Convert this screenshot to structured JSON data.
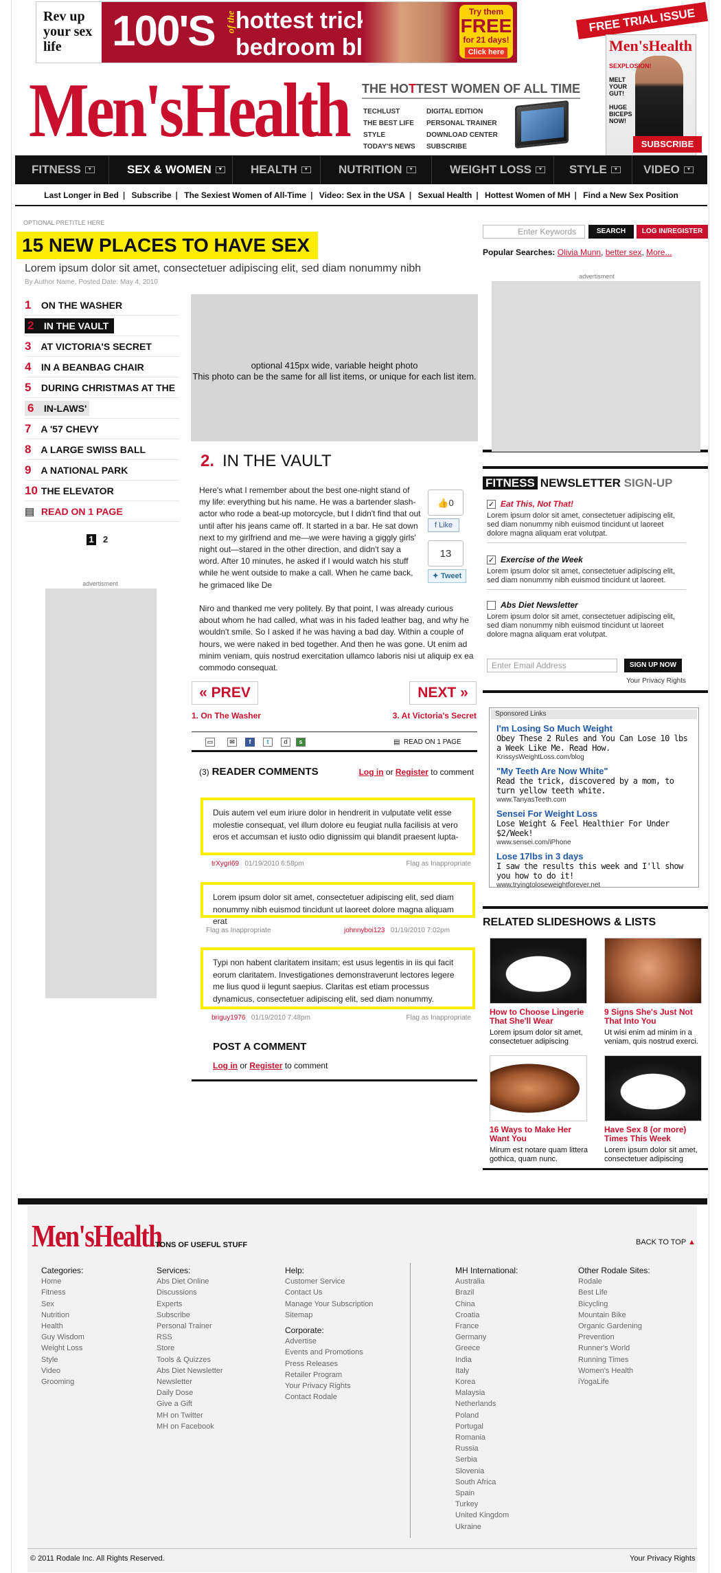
{
  "ad_top": {
    "left_text": "Rev up your sex life",
    "big": "100'S",
    "of_the": "of the",
    "line1": "hottest tricks",
    "line1_for": "for",
    "line2": "bedroom bliss",
    "try": "Try them",
    "free": "FREE",
    "days": "for 21 days!",
    "cta": "Click here"
  },
  "trial": {
    "label": "FREE TRIAL ISSUE",
    "cover_title": "Men'sHealth",
    "cover_text": [
      "SEXPLOSION!",
      "MELT YOUR GUT!",
      "HUGE BICEPS NOW!"
    ],
    "subscribe": "SUBSCRIBE"
  },
  "header": {
    "logo": "Men'sHealth",
    "hottest_pre": "THE HO",
    "hottest_accent": "T",
    "hottest_post": "TEST WOMEN OF ALL TIME",
    "links_col1": [
      "TECHLUST",
      "THE BEST LIFE",
      "STYLE",
      "TODAY'S NEWS"
    ],
    "links_col2": [
      "DIGITAL EDITION",
      "PERSONAL TRAINER",
      "DOWNLOAD CENTER",
      "SUBSCRIBE"
    ]
  },
  "nav": {
    "items": [
      {
        "label": "FITNESS"
      },
      {
        "label": "SEX & WOMEN"
      },
      {
        "label": "HEALTH"
      },
      {
        "label": "NUTRITION"
      },
      {
        "label": "WEIGHT LOSS"
      },
      {
        "label": "STYLE"
      },
      {
        "label": "VIDEO"
      }
    ],
    "active_index": 1,
    "subnav": [
      "Last Longer in Bed",
      "Subscribe",
      "The Sexiest Women of All-Time",
      "Video: Sex in the USA",
      "Sexual Health",
      "Hottest Women of MH",
      "Find a New Sex Position"
    ]
  },
  "article": {
    "pretitle": "OPTIONAL PRETITLE HERE",
    "title": "15 NEW PLACES TO HAVE SEX",
    "dek": "Lorem ipsum dolor sit amet, consectetuer adipiscing elit, sed diam nonummy nibh",
    "byline": "By Author Name, Posted Date: May 4, 2010",
    "list": [
      {
        "n": "1",
        "label": "ON THE WASHER"
      },
      {
        "n": "2",
        "label": "IN THE VAULT"
      },
      {
        "n": "3",
        "label": "AT VICTORIA'S SECRET"
      },
      {
        "n": "4",
        "label": "IN A BEANBAG CHAIR"
      },
      {
        "n": "5",
        "label": "DURING CHRISTMAS AT THE"
      },
      {
        "n": "6",
        "label": "IN-LAWS'"
      },
      {
        "n": "7",
        "label": "A '57 CHEVY"
      },
      {
        "n": "8",
        "label": "A LARGE SWISS BALL"
      },
      {
        "n": "9",
        "label": "A NATIONAL PARK"
      },
      {
        "n": "10",
        "label": "THE ELEVATOR"
      }
    ],
    "read_on_one": "READ ON 1 PAGE",
    "pages": [
      "1",
      "2"
    ],
    "ad_label": "advertisment",
    "photo_line1": "optional 415px wide, variable height photo",
    "photo_line2": "This photo can be the same for all list items, or unique for each list item.",
    "section_num": "2.",
    "section_title": "IN THE VAULT",
    "body_narrow": "Here's what I remember about the best one-night stand of my life: everything but his name. He was a bartender slash-actor who rode a beat-up motorcycle, but I didn't find that out until after his jeans came off. It started in a bar. He sat down next to my girlfriend and me—we were having a giggly girls' night out—stared in the other direction, and didn't say a word.  After 10 minutes, he asked if I would watch his stuff while he went outside to make a call. When he came back, he grimaced like De",
    "body_wide": "Niro and thanked me very politely. By that point, I was already curious about whom he had called, what was in his faded leather bag, and why he wouldn't smile. So I asked if he was having a bad day. Within a couple of hours, we were naked in bed together. And then he was gone. Ut enim ad minim veniam, quis nostrud exercitation ullamco laboris nisi ut aliquip ex ea commodo consequat.",
    "like_count": "0",
    "like_label": "Like",
    "tweet_count": "13",
    "tweet_label": "Tweet",
    "prev": "PREV",
    "next": "NEXT",
    "prev_label": "1. On The Washer",
    "next_label": "3. At Victoria's Secret",
    "toolbar_read": "READ ON 1 PAGE"
  },
  "comments": {
    "count": "(3)",
    "title": "READER COMMENTS",
    "login": "Log in",
    "or": "or",
    "register": "Register",
    "to_comment": "to comment",
    "items": [
      {
        "text": "Duis autem vel eum iriure dolor in hendrerit in vulputate velit esse molestie consequat, vel illum dolore eu feugiat nulla facilisis at vero eros et accumsan et iusto odio dignissim qui blandit praesent lupta-",
        "user": "trXygrl69",
        "date": "01/19/2010  6:58pm",
        "flag": "Flag as Inappropriate"
      },
      {
        "text": "Lorem ipsum dolor sit amet, consectetuer adipiscing elit, sed diam nonummy nibh euismod tincidunt ut laoreet dolore magna aliquam erat",
        "user": "johnnyboi123",
        "date": "01/19/2010  7:02pm",
        "flag": "Flag as Inappropriate"
      },
      {
        "text": "Typi non habent claritatem insitam; est usus legentis in iis qui facit eorum claritatem. Investigationes demonstraverunt lectores legere me lius quod ii legunt saepius. Claritas est etiam processus dynamicus, consectetuer adipiscing elit, sed diam nonummy.",
        "user": "briguy1976",
        "date": "01/19/2010  7:48pm",
        "flag": "Flag as Inappropriate"
      }
    ],
    "post_title": "POST A COMMENT"
  },
  "sidebar": {
    "search_placeholder": "Enter Keywords",
    "search_btn": "SEARCH",
    "logreg_btn": "LOG IN/REGISTER",
    "popular_label": "Popular Searches:",
    "popular": [
      "Olivia Munn",
      "better sex",
      "More..."
    ],
    "ad_label": "advertisment",
    "newsletter": {
      "fitness": "FITNESS",
      "newsletter": "NEWSLETTER",
      "signup": "SIGN-UP",
      "options": [
        {
          "checked": true,
          "title": "Eat This, Not That!",
          "desc": "Lorem ipsum dolor sit amet, consectetuer adipiscing elit, sed diam nonummy nibh euismod tincidunt ut laoreet dolore magna aliquam erat volutpat."
        },
        {
          "checked": true,
          "title": "Exercise of the Week",
          "desc": "Lorem ipsum dolor sit amet, consectetuer adipiscing elit, sed diam nonummy nibh euismod tincidunt ut laoreet."
        },
        {
          "checked": false,
          "title": "Abs Diet Newsletter",
          "desc": "Lorem ipsum dolor sit amet, consectetuer adipiscing elit, sed diam nonummy nibh euismod tincidunt ut laoreet dolore magna aliquam erat volutpat."
        }
      ],
      "email_placeholder": "Enter Email Address",
      "signup_btn": "SIGN UP NOW",
      "privacy": "Your Privacy Rights"
    },
    "sponsored": {
      "header": "Sponsored Links",
      "items": [
        {
          "title": "I'm Losing So Much Weight",
          "desc": "Obey These 2 Rules and You Can Lose 10 lbs a Week Like Me. Read How.",
          "url": "KrissysWeightLoss.com/blog"
        },
        {
          "title": "\"My Teeth Are Now White\"",
          "desc": "Read the trick, discovered by a mom, to turn yellow teeth white.",
          "url": "www.TanyasTeeth.com"
        },
        {
          "title": "Sensei For Weight Loss",
          "desc": "Lose Weight & Feel Healthier For Under $2/Week!",
          "url": "www.sensei.com/iPhone"
        },
        {
          "title": "Lose 17lbs in 3 days",
          "desc": "I saw the results this week and I'll show you how to do it!",
          "url": "www.tryingtoloseweightforever.net"
        }
      ]
    },
    "related_title": "RELATED SLIDESHOWS & LISTS",
    "related": [
      {
        "title": "How to Choose Lingerie That She'll Wear",
        "desc": "Lorem ipsum dolor sit amet, consectetuer adipiscing"
      },
      {
        "title": "9 Signs She's Just Not That Into You",
        "desc": "Ut wisi enim ad minim in a veniam, quis nostrud exerci."
      },
      {
        "title": "16 Ways to Make Her Want You",
        "desc": "Mirum est notare quam littera gothica, quam nunc."
      },
      {
        "title": "Have Sex 8 (or more) Times This Week",
        "desc": "Lorem ipsum dolor sit amet, consectetuer adipiscing"
      }
    ]
  },
  "footer": {
    "logo": "Men'sHealth",
    "tons": "TONS OF USEFUL STUFF",
    "back_to_top": "BACK TO TOP",
    "categories_h": "Categories:",
    "categories": [
      "Home",
      "Fitness",
      "Sex",
      "Nutrition",
      "Health",
      "Guy Wisdom",
      "Weight Loss",
      "Style",
      "Video",
      "Grooming"
    ],
    "services_h": "Services:",
    "services": [
      "Abs Diet Online",
      "Discussions",
      "Experts",
      "Subscribe",
      "Personal Trainer",
      "RSS",
      "Store",
      "Tools & Quizzes",
      "Abs Diet Newsletter",
      "Newsletter",
      "Daily Dose",
      "Give a Gift",
      "MH on Twitter",
      "MH on Facebook"
    ],
    "help_h": "Help:",
    "help": [
      "Customer Service",
      "Contact Us",
      "Manage Your Subscription",
      "Sitemap"
    ],
    "corporate_h": "Corporate:",
    "corporate": [
      "Advertise",
      "Events and Promotions",
      "Press Releases",
      "Retailer Program",
      "Your Privacy Rights",
      "Contact Rodale"
    ],
    "intl_h": "MH International:",
    "intl": [
      "Australia",
      "Brazil",
      "China",
      "Croatia",
      "France",
      "Germany",
      "Greece",
      "India",
      "Italy",
      "Korea",
      "Malaysia",
      "Netherlands",
      "Poland",
      "Portugal",
      "Romania",
      "Russia",
      "Serbia",
      "Slovenia",
      "South Africa",
      "Spain",
      "Turkey",
      "United Kingdom",
      "Ukraine"
    ],
    "rodale_h": "Other Rodale Sites:",
    "rodale": [
      "Rodale",
      "Best Life",
      "Bicycling",
      "Mountain Bike",
      "Organic Gardening",
      "Prevention",
      "Runner's World",
      "Running Times",
      "Women's Health",
      "iYogaLife"
    ],
    "copyright": "© 2011 Rodale Inc. All Rights Reserved.",
    "privacy": "Your Privacy Rights"
  },
  "colors": {
    "brand_red": "#c8102e",
    "highlight_yellow": "#ffed00",
    "nav_black": "#111111",
    "link_blue": "#1f58a8"
  }
}
